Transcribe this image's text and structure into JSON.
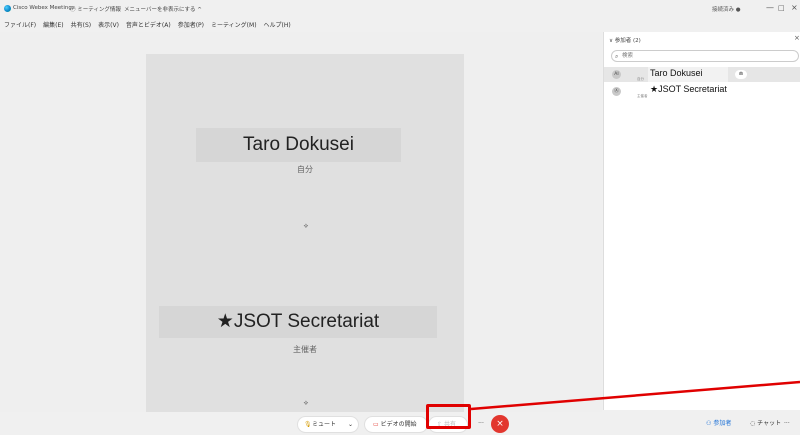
{
  "titlebar": {
    "app_name": "Cisco Webex Meetings",
    "meeting_info": "ⓘ ミーティング情報",
    "menu_toggle": "メニューバーを非表示にする ^",
    "status": "接続済み ●",
    "minimize": "—",
    "maximize": "□",
    "close": "×"
  },
  "menubar": [
    "ファイル(F)",
    "編集(E)",
    "共有(S)",
    "表示(V)",
    "音声とビデオ(A)",
    "参加者(P)",
    "ミーティング(M)",
    "ヘルプ(H)"
  ],
  "stage": {
    "tiles": [
      {
        "name": "Taro Dokusei",
        "role": "自分"
      },
      {
        "name": "★JSOT Secretariat",
        "role": "主催者"
      }
    ]
  },
  "panel": {
    "header": "∨ 参加者 (2)",
    "close": "×",
    "search_placeholder": "検索",
    "participants": [
      {
        "initials": "AI",
        "name": "Taro Dokusei",
        "sub": "自分",
        "badge": "⋒",
        "selected": true
      },
      {
        "initials": "Ⓐ",
        "name": "★JSOT Secretariat",
        "sub": "主催者",
        "selected": false
      }
    ]
  },
  "toolbar": {
    "mute": "ミュート",
    "mute_dropdown": "⌄",
    "video": "ビデオの開始",
    "share": "共有",
    "more": "···",
    "end": "×",
    "participants": "参加者",
    "chat": "チャット",
    "overflow": "···"
  },
  "colors": {
    "end_button": "#e2362e",
    "highlight": "#e00000",
    "accent": "#1a6fd6"
  }
}
